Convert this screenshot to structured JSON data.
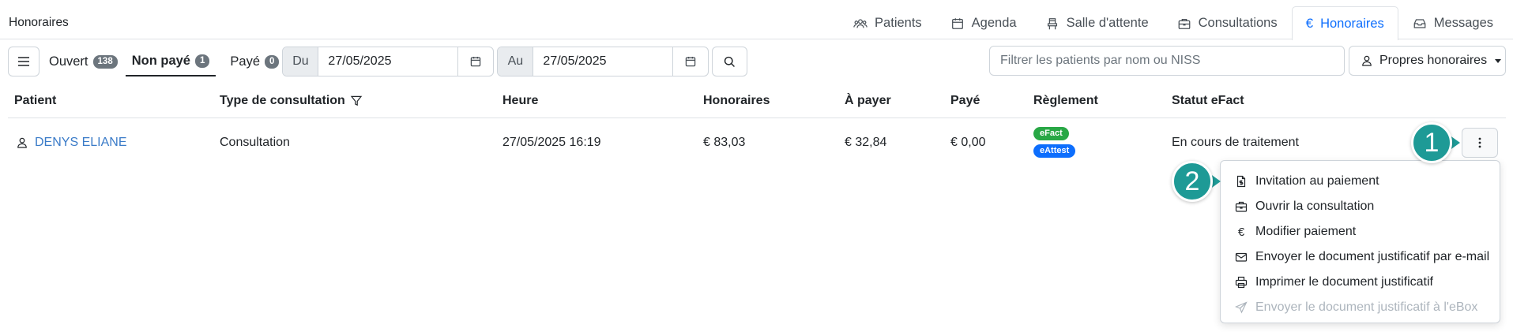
{
  "header": {
    "title": "Honoraires",
    "tabs": [
      {
        "label": "Patients",
        "icon": "users-icon"
      },
      {
        "label": "Agenda",
        "icon": "calendar-icon"
      },
      {
        "label": "Salle d'attente",
        "icon": "chair-icon"
      },
      {
        "label": "Consultations",
        "icon": "briefcase-icon"
      },
      {
        "label": "Honoraires",
        "icon": "euro-icon",
        "active": true
      },
      {
        "label": "Messages",
        "icon": "inbox-icon"
      }
    ]
  },
  "filters": {
    "open_label": "Ouvert",
    "open_count": "138",
    "unpaid_label": "Non payé",
    "unpaid_count": "1",
    "paid_label": "Payé",
    "paid_count": "0",
    "from_label": "Du",
    "from_date": "27/05/2025",
    "to_label": "Au",
    "to_date": "27/05/2025",
    "search_placeholder": "Filtrer les patients par nom ou NISS",
    "owner_label": "Propres honoraires"
  },
  "table": {
    "columns": [
      "Patient",
      "Type de consultation",
      "Heure",
      "Honoraires",
      "À payer",
      "Payé",
      "Règlement",
      "Statut eFact"
    ],
    "rows": [
      {
        "patient": "DENYS ELIANE",
        "type": "Consultation",
        "time": "27/05/2025 16:19",
        "fee": "€ 83,03",
        "to_pay": "€ 32,84",
        "paid": "€ 0,00",
        "badges": [
          "eFact",
          "eAttest"
        ],
        "status": "En cours de traitement"
      }
    ]
  },
  "menu": {
    "items": [
      {
        "label": "Invitation au paiement",
        "icon": "invoice-icon"
      },
      {
        "label": "Ouvrir la consultation",
        "icon": "briefcase-icon"
      },
      {
        "label": "Modifier paiement",
        "icon": "euro-icon"
      },
      {
        "label": "Envoyer le document justificatif par e-mail",
        "icon": "envelope-icon"
      },
      {
        "label": "Imprimer le document justificatif",
        "icon": "printer-icon"
      },
      {
        "label": "Envoyer le document justificatif à l'eBox",
        "icon": "send-icon",
        "disabled": true
      }
    ]
  },
  "callouts": [
    "1",
    "2"
  ],
  "colors": {
    "accent": "#0d6efd",
    "callout": "#1e9a96",
    "efact": "#28a745",
    "eattest": "#0d6efd"
  }
}
